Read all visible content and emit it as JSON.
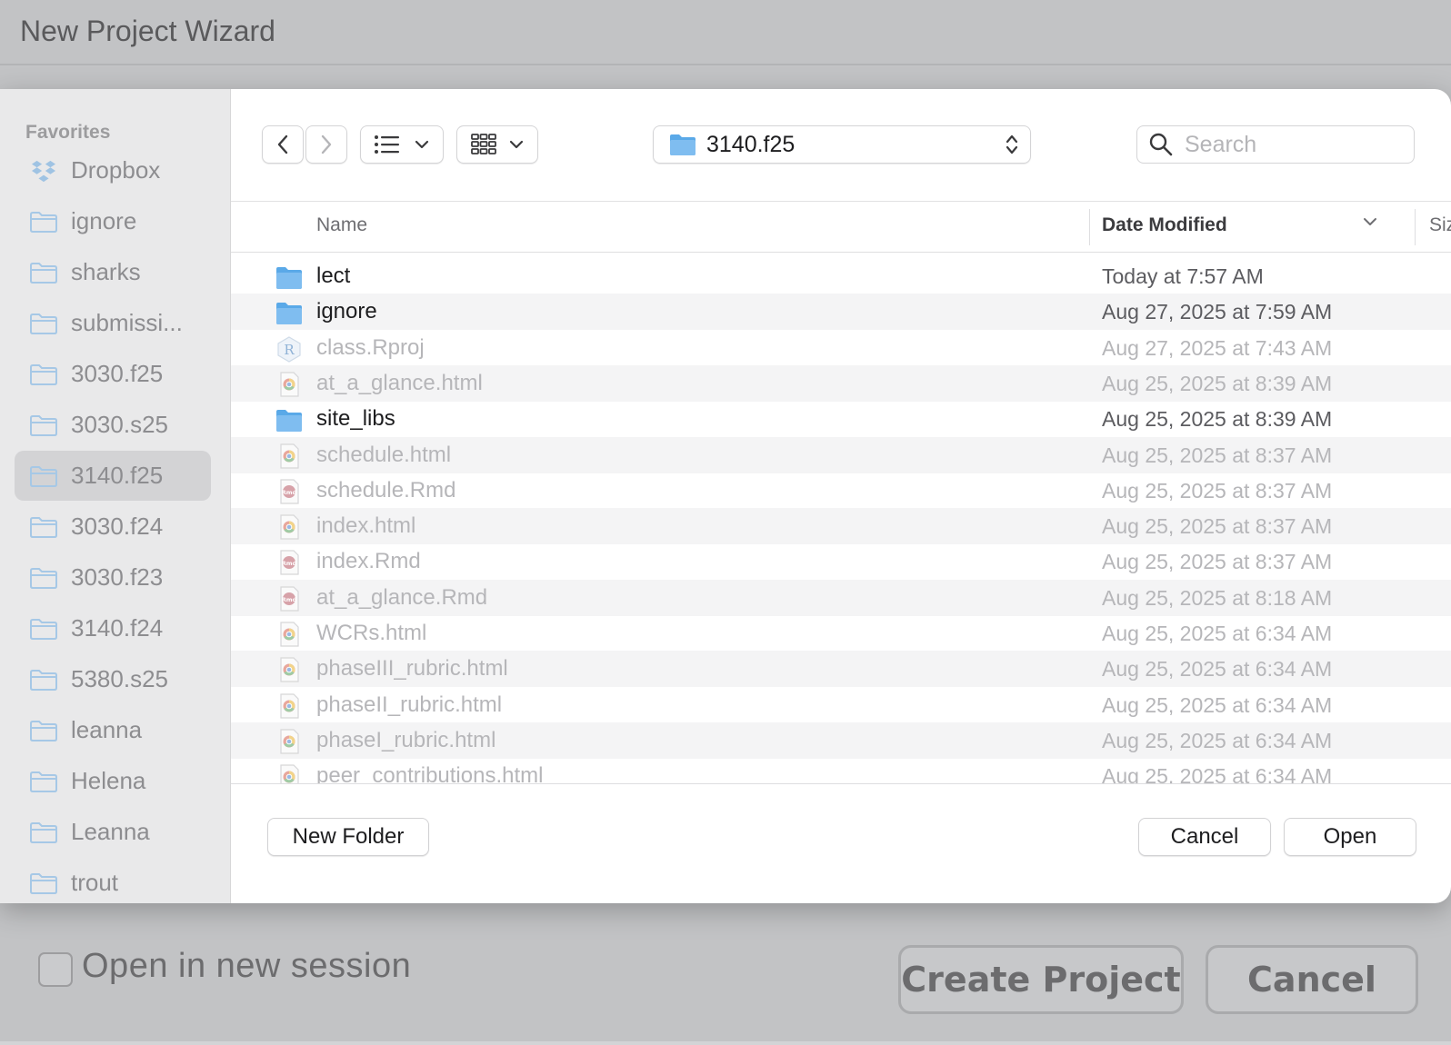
{
  "wizard": {
    "title": "New Project Wizard",
    "open_new_session_label": "Open in new session",
    "create_project_label": "Create Project",
    "cancel_label": "Cancel"
  },
  "sidebar": {
    "heading": "Favorites",
    "items": [
      {
        "label": "Dropbox",
        "icon": "dropbox-icon"
      },
      {
        "label": "ignore",
        "icon": "folder-icon"
      },
      {
        "label": "sharks",
        "icon": "folder-icon"
      },
      {
        "label": "submissi...",
        "icon": "folder-icon"
      },
      {
        "label": "3030.f25",
        "icon": "folder-icon"
      },
      {
        "label": "3030.s25",
        "icon": "folder-icon"
      },
      {
        "label": "3140.f25",
        "icon": "folder-icon",
        "selected": true
      },
      {
        "label": "3030.f24",
        "icon": "folder-icon"
      },
      {
        "label": "3030.f23",
        "icon": "folder-icon"
      },
      {
        "label": "3140.f24",
        "icon": "folder-icon"
      },
      {
        "label": "5380.s25",
        "icon": "folder-icon"
      },
      {
        "label": "leanna",
        "icon": "folder-icon"
      },
      {
        "label": "Helena",
        "icon": "folder-icon"
      },
      {
        "label": "Leanna",
        "icon": "folder-icon"
      },
      {
        "label": "trout",
        "icon": "folder-icon"
      }
    ]
  },
  "toolbar": {
    "current_folder": "3140.f25",
    "search_placeholder": "Search"
  },
  "columns": {
    "name": "Name",
    "date_modified": "Date Modified",
    "size": "Siz"
  },
  "files": [
    {
      "name": "lect",
      "date": "Today at 7:57 AM",
      "type": "folder",
      "enabled": true
    },
    {
      "name": "ignore",
      "date": "Aug 27, 2025 at 7:59 AM",
      "type": "folder",
      "enabled": true
    },
    {
      "name": "class.Rproj",
      "date": "Aug 27, 2025 at 7:43 AM",
      "type": "rproj",
      "enabled": false
    },
    {
      "name": "at_a_glance.html",
      "date": "Aug 25, 2025 at 8:39 AM",
      "type": "html",
      "enabled": false
    },
    {
      "name": "site_libs",
      "date": "Aug 25, 2025 at 8:39 AM",
      "type": "folder",
      "enabled": true
    },
    {
      "name": "schedule.html",
      "date": "Aug 25, 2025 at 8:37 AM",
      "type": "html",
      "enabled": false
    },
    {
      "name": "schedule.Rmd",
      "date": "Aug 25, 2025 at 8:37 AM",
      "type": "rmd",
      "enabled": false
    },
    {
      "name": "index.html",
      "date": "Aug 25, 2025 at 8:37 AM",
      "type": "html",
      "enabled": false
    },
    {
      "name": "index.Rmd",
      "date": "Aug 25, 2025 at 8:37 AM",
      "type": "rmd",
      "enabled": false
    },
    {
      "name": "at_a_glance.Rmd",
      "date": "Aug 25, 2025 at 8:18 AM",
      "type": "rmd",
      "enabled": false
    },
    {
      "name": "WCRs.html",
      "date": "Aug 25, 2025 at 6:34 AM",
      "type": "html",
      "enabled": false
    },
    {
      "name": "phaseIII_rubric.html",
      "date": "Aug 25, 2025 at 6:34 AM",
      "type": "html",
      "enabled": false
    },
    {
      "name": "phaseII_rubric.html",
      "date": "Aug 25, 2025 at 6:34 AM",
      "type": "html",
      "enabled": false
    },
    {
      "name": "phaseI_rubric.html",
      "date": "Aug 25, 2025 at 6:34 AM",
      "type": "html",
      "enabled": false
    },
    {
      "name": "peer_contributions.html",
      "date": "Aug 25, 2025 at 6:34 AM",
      "type": "html",
      "enabled": false
    }
  ],
  "footer": {
    "new_folder_label": "New Folder",
    "cancel_label": "Cancel",
    "open_label": "Open"
  },
  "colors": {
    "folder_blue": "#5aa9e8",
    "sidebar_icon": "#a6c8e6",
    "selected_bg": "#d3d3d5"
  }
}
